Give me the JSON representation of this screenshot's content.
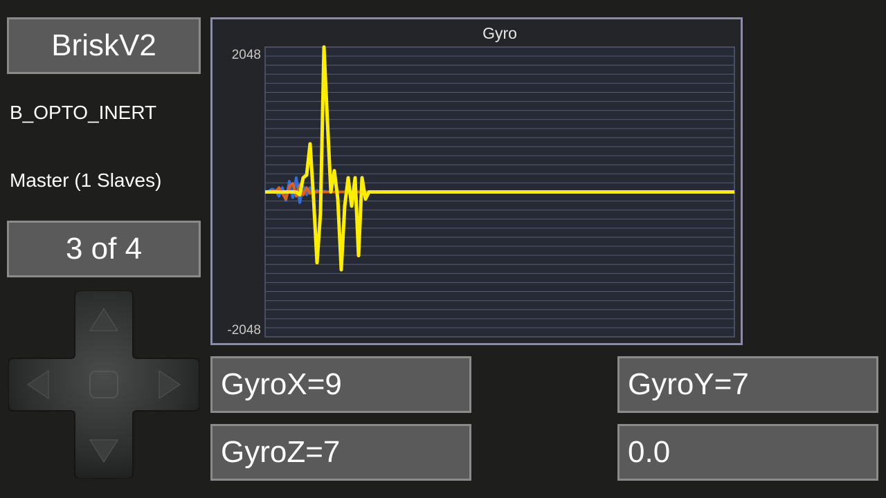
{
  "header": {
    "title": "BriskV2",
    "device_id": "B_OPTO_INERT",
    "role": "Master (1 Slaves)",
    "page_indicator": "3 of 4"
  },
  "readouts": {
    "gyro_x": "GyroX=9",
    "gyro_y": "GyroY=7",
    "gyro_z": "GyroZ=7",
    "extra": "0.0"
  },
  "dpad": {
    "up": "chevron-up-icon",
    "down": "chevron-down-icon",
    "left": "chevron-left-icon",
    "right": "chevron-right-icon",
    "center": "center-button"
  },
  "chart_data": {
    "type": "line",
    "title": "Gyro",
    "ylim": [
      -2048,
      2048
    ],
    "ytick_labels": [
      "2048",
      "-2048"
    ],
    "grid": true,
    "x": [
      0,
      5,
      10,
      15,
      20,
      25,
      30,
      35,
      40,
      45,
      50,
      55,
      60,
      65,
      70,
      75,
      80,
      85,
      90,
      95,
      100,
      105,
      110,
      115,
      120,
      125,
      130,
      135,
      140,
      145,
      150,
      155,
      160,
      165,
      170,
      175,
      180,
      185,
      190,
      195,
      200,
      250,
      300,
      350,
      400,
      450,
      500,
      550,
      600,
      650,
      678
    ],
    "series": [
      {
        "color": "#2f6fe0",
        "values": [
          0,
          10,
          40,
          20,
          -60,
          60,
          -120,
          150,
          -80,
          200,
          -150,
          80,
          -40,
          60,
          -30,
          20,
          -10,
          10,
          0,
          0,
          0,
          0,
          0,
          0,
          0,
          0,
          0,
          0,
          0,
          0,
          0,
          0,
          0,
          0,
          0,
          0,
          0,
          0,
          0,
          0,
          0,
          0,
          0,
          0,
          0,
          0,
          0,
          0,
          0,
          0,
          0
        ]
      },
      {
        "color": "#e0601c",
        "values": [
          0,
          0,
          20,
          0,
          60,
          -20,
          -100,
          80,
          120,
          -60,
          100,
          -40,
          60,
          -20,
          10,
          0,
          0,
          0,
          0,
          0,
          0,
          0,
          0,
          0,
          0,
          0,
          0,
          0,
          0,
          0,
          0,
          0,
          0,
          0,
          0,
          0,
          0,
          0,
          0,
          0,
          0,
          0,
          0,
          0,
          0,
          0,
          0,
          0,
          0,
          0,
          0
        ]
      },
      {
        "color": "#ffee00",
        "values": [
          0,
          0,
          0,
          0,
          0,
          0,
          0,
          0,
          0,
          0,
          -40,
          200,
          240,
          680,
          -100,
          -1000,
          -300,
          2048,
          1000,
          0,
          300,
          -100,
          -1100,
          -200,
          200,
          -200,
          200,
          -900,
          200,
          -100,
          0,
          0,
          0,
          0,
          0,
          0,
          0,
          0,
          0,
          0,
          0,
          0,
          0,
          0,
          0,
          0,
          0,
          0,
          0,
          0,
          0
        ]
      }
    ]
  }
}
